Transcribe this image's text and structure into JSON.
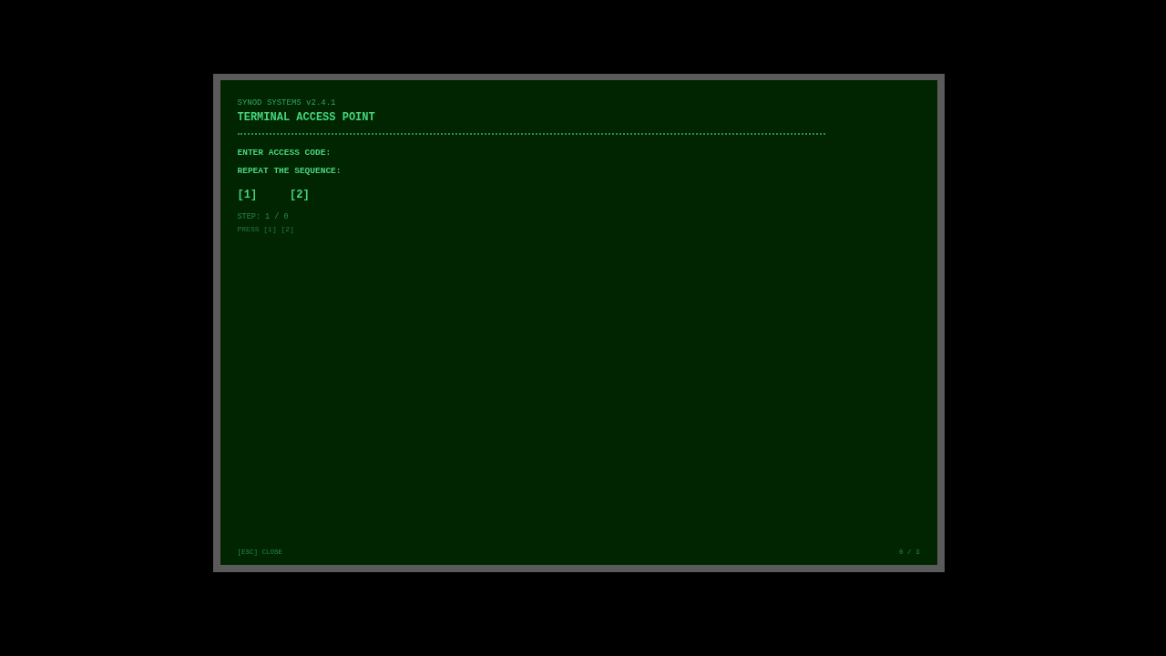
{
  "header": {
    "subtitle": "SYNOD SYSTEMS v2.4.1",
    "title": "TERMINAL ACCESS POINT"
  },
  "prompts": [
    "ENTER ACCESS CODE:",
    "REPEAT THE SEQUENCE:"
  ],
  "keys": [
    "[1]",
    "[2]"
  ],
  "step": "STEP: 1 / 0",
  "hint": "PRESS [1] [2]",
  "footer": {
    "close": "[ESC] CLOSE",
    "progress": "0 / 3"
  }
}
